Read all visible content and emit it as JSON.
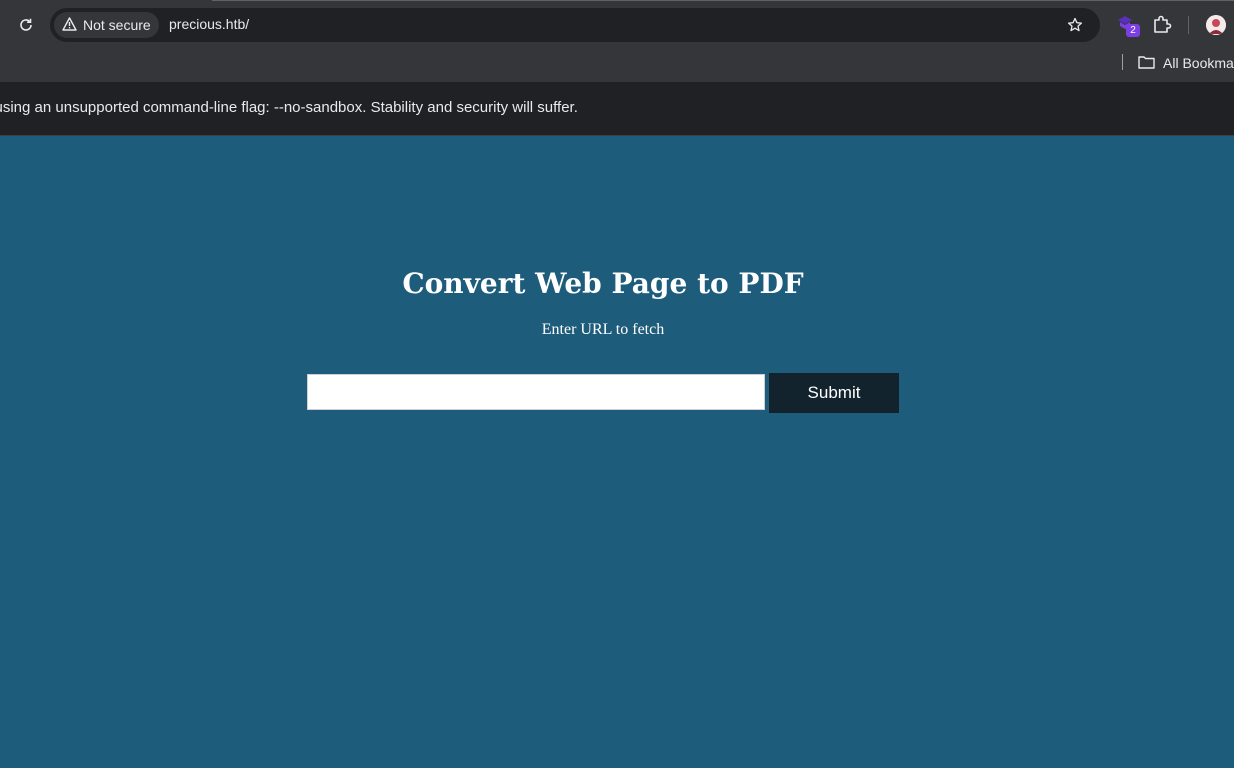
{
  "browser": {
    "security_label": "Not secure",
    "url": "precious.htb/",
    "extension_badge": "2",
    "bookmarks_label": "All Bookmarks",
    "icons": {
      "reload": "reload-icon",
      "warning": "warning-icon",
      "star": "star-icon",
      "extension": "extension-icon",
      "puzzle": "puzzle-icon",
      "folder": "folder-icon",
      "avatar": "avatar"
    }
  },
  "infobar": {
    "message": "e using an unsupported command-line flag: --no-sandbox. Stability and security will suffer."
  },
  "page": {
    "title": "Convert Web Page to PDF",
    "subtitle": "Enter URL to fetch",
    "url_input_value": "",
    "url_input_placeholder": "",
    "submit_label": "Submit",
    "colors": {
      "background": "#1e5c7b",
      "button": "#12232e",
      "text": "#ffffff"
    }
  }
}
